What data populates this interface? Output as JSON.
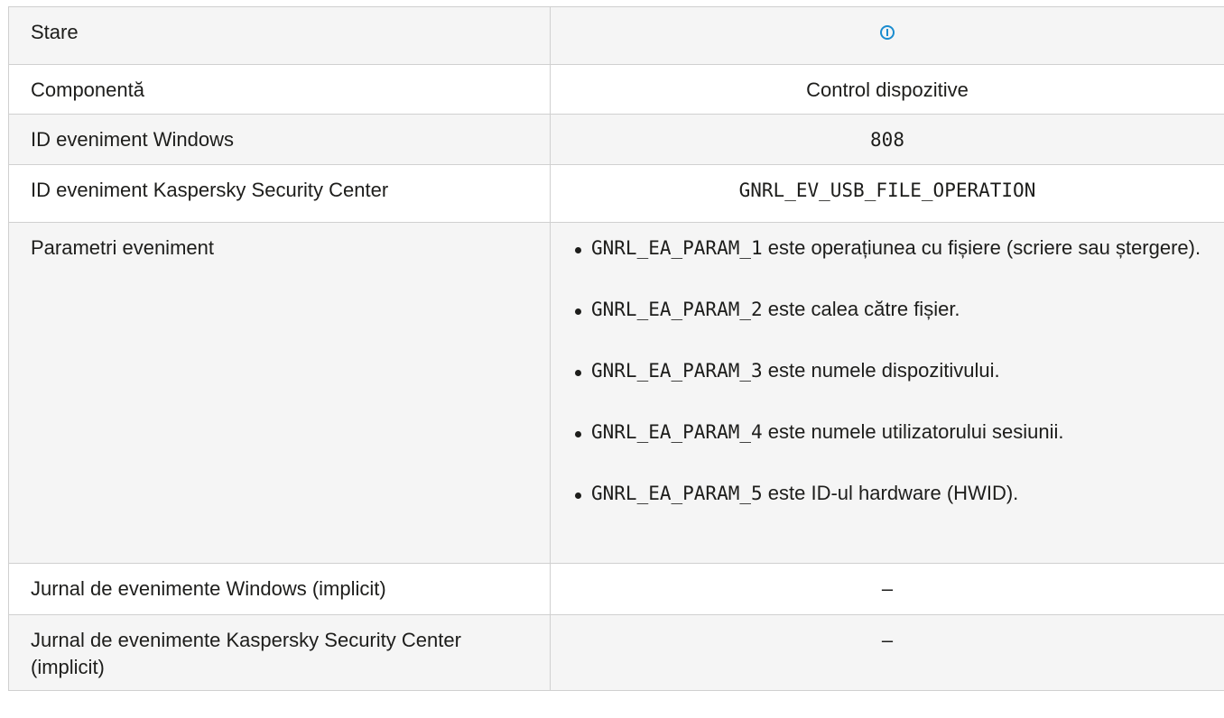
{
  "table": {
    "rows": [
      {
        "label": "Stare",
        "value_icon": "info-circle-icon"
      },
      {
        "label": "Componentă",
        "value": "Control dispozitive"
      },
      {
        "label": "ID eveniment Windows",
        "value": "808"
      },
      {
        "label": "ID eveniment Kaspersky Security Center",
        "value": "GNRL_EV_USB_FILE_OPERATION"
      },
      {
        "label": "Parametri eveniment",
        "params": [
          {
            "code": "GNRL_EA_PARAM_1",
            "text": " este operațiunea cu fișiere (scriere sau ștergere)."
          },
          {
            "code": "GNRL_EA_PARAM_2",
            "text": " este calea către fișier."
          },
          {
            "code": "GNRL_EA_PARAM_3",
            "text": " este numele dispozitivului."
          },
          {
            "code": "GNRL_EA_PARAM_4",
            "text": " este numele utilizatorului sesiunii."
          },
          {
            "code": "GNRL_EA_PARAM_5",
            "text": " este ID-ul hardware (HWID)."
          }
        ]
      },
      {
        "label": "Jurnal de evenimente Windows (implicit)",
        "value": "–"
      },
      {
        "label": "Jurnal de evenimente Kaspersky Security Center (implicit)",
        "value": "–"
      }
    ]
  },
  "colors": {
    "border": "#d0d0d0",
    "shaded_row": "#f5f5f5",
    "icon": "#1a8ccf"
  }
}
